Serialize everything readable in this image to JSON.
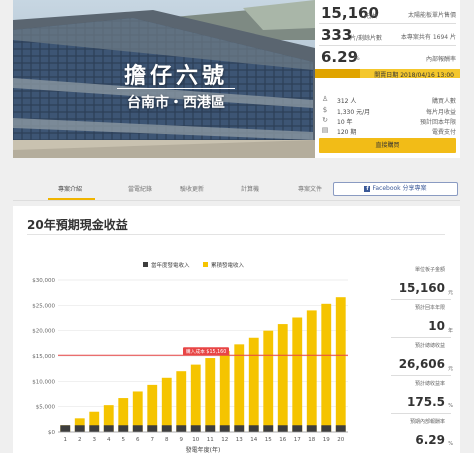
{
  "hero": {
    "title": "擔仔六號",
    "subtitle": "台南市・西港區"
  },
  "info": {
    "price": {
      "value": "15,160",
      "unit": "元/片",
      "label": "太陽能板單片售價"
    },
    "remaining": {
      "value": "333",
      "unit": "片/剩餘片數",
      "label": "本專案共有 1694 片"
    },
    "irr": {
      "value": "6.29",
      "unit": "%",
      "label": "內部報酬率"
    },
    "start_date": "開賣日期 2018/04/16 13:00",
    "start_progress": 0.31,
    "rows": [
      {
        "icon": "person-icon",
        "glyph": "♙",
        "value": "312 人",
        "label": "購買人數"
      },
      {
        "icon": "dollar-icon",
        "glyph": "$",
        "value": "1,330 元/月",
        "label": "每片月收益"
      },
      {
        "icon": "refresh-icon",
        "glyph": "↻",
        "value": "10 年",
        "label": "預計回本年限"
      },
      {
        "icon": "clipboard-icon",
        "glyph": "▤",
        "value": "120 期",
        "label": "電費支付"
      }
    ],
    "buy_label": "直接購買"
  },
  "tabs": {
    "items": [
      "專案介紹",
      "當電紀錄",
      "驗收更新",
      "計算機",
      "專案文件"
    ],
    "active": 0,
    "facebook_label": "Facebook 分享專案"
  },
  "card": {
    "title": "20年預期現金收益",
    "side": [
      {
        "label": "單位板子金額",
        "value": "15,160",
        "unit": "元"
      },
      {
        "label": "預計回本年限",
        "value": "10",
        "unit": "年"
      },
      {
        "label": "預計總總收益",
        "value": "26,606",
        "unit": "元"
      },
      {
        "label": "預計總收益率",
        "value": "175.5",
        "unit": "%"
      },
      {
        "label": "預期內部報酬率",
        "value": "6.29",
        "unit": "%"
      }
    ]
  },
  "colors": {
    "accent": "#f2bc17",
    "annual": "#3d3d3d",
    "cumulative": "#f5c400",
    "reference": "#e84545"
  },
  "chart_data": {
    "type": "bar",
    "categories": [
      "1",
      "2",
      "3",
      "4",
      "5",
      "6",
      "7",
      "8",
      "9",
      "10",
      "11",
      "12",
      "13",
      "14",
      "15",
      "16",
      "17",
      "18",
      "19",
      "20"
    ],
    "series": [
      {
        "name": "當年度發電收入",
        "values": [
          1330,
          1330,
          1330,
          1330,
          1330,
          1330,
          1330,
          1330,
          1330,
          1330,
          1330,
          1330,
          1330,
          1330,
          1330,
          1330,
          1330,
          1330,
          1330,
          1330
        ]
      },
      {
        "name": "累積發電收入",
        "values": [
          1330,
          2700,
          4000,
          5300,
          6700,
          8000,
          9300,
          10700,
          12000,
          13300,
          14600,
          16000,
          17300,
          18600,
          20000,
          21300,
          22600,
          24000,
          25300,
          26606
        ]
      }
    ],
    "reference_line": {
      "value": 15160,
      "label": "購入成本 $15,160"
    },
    "xlabel": "發電年度(年)",
    "ylabel": "",
    "ylim": [
      0,
      30000
    ],
    "yticks": [
      "$0",
      "$5,000",
      "$10,000",
      "$15,000",
      "$20,000",
      "$25,000",
      "$30,000"
    ],
    "legend": "top-center",
    "grid": true
  }
}
